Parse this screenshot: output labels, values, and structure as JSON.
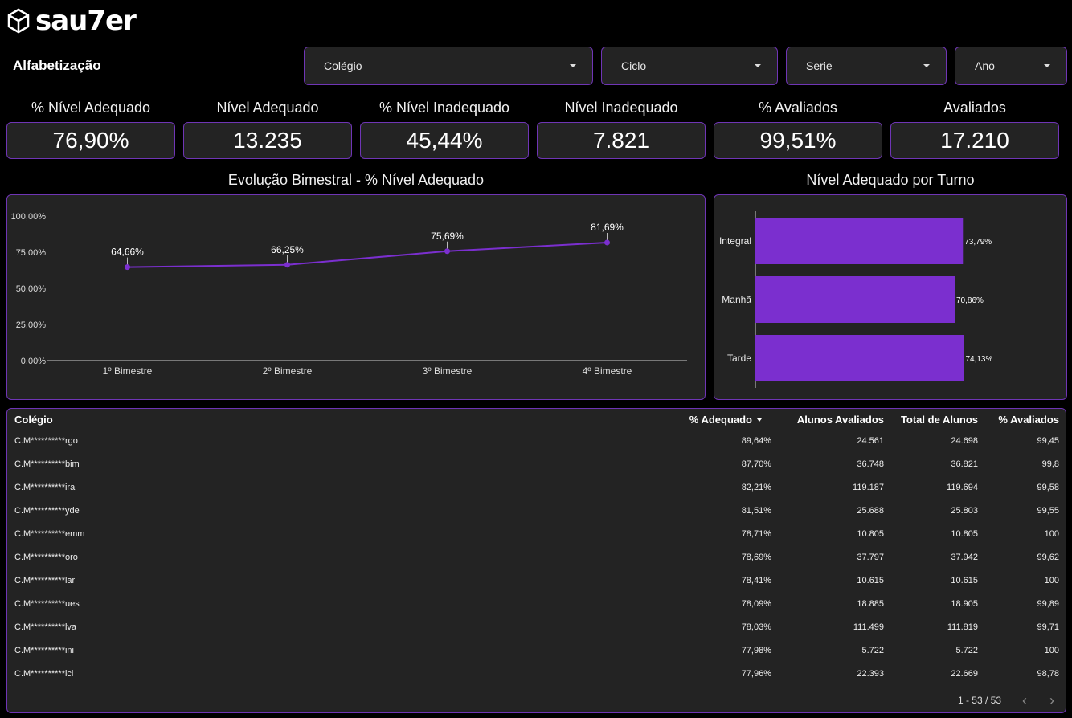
{
  "brand": {
    "name": "sau7er"
  },
  "page": {
    "title": "Alfabetização"
  },
  "filters": [
    {
      "label": "Colégio"
    },
    {
      "label": "Ciclo"
    },
    {
      "label": "Serie"
    },
    {
      "label": "Ano"
    }
  ],
  "kpis": [
    {
      "label": "% Nível Adequado",
      "value": "76,90%"
    },
    {
      "label": "Nível Adequado",
      "value": "13.235"
    },
    {
      "label": "% Nível Inadequado",
      "value": "45,44%"
    },
    {
      "label": "Nível Inadequado",
      "value": "7.821"
    },
    {
      "label": "% Avaliados",
      "value": "99,51%"
    },
    {
      "label": "Avaliados",
      "value": "17.210"
    }
  ],
  "colors": {
    "accent": "#7b2fcf",
    "border": "#6f35b5",
    "panel": "#232323",
    "background": "#000000"
  },
  "chart_data": [
    {
      "type": "line",
      "title": "Evolução Bimestral - % Nível Adequado",
      "categories": [
        "1º Bimestre",
        "2º Bimestre",
        "3º Bimestre",
        "4º Bimestre"
      ],
      "values": [
        64.66,
        66.25,
        75.69,
        81.69
      ],
      "labels": [
        "64,66%",
        "66,25%",
        "75,69%",
        "81,69%"
      ],
      "yticks": [
        "0,00%",
        "25,00%",
        "50,00%",
        "75,00%",
        "100,00%"
      ],
      "ylim": [
        0,
        100
      ],
      "color": "#7b2fcf",
      "grid": false
    },
    {
      "type": "bar",
      "orientation": "horizontal",
      "title": "Nível Adequado por Turno",
      "categories": [
        "Integral",
        "Manhã",
        "Tarde"
      ],
      "values": [
        73.79,
        70.86,
        74.13
      ],
      "labels": [
        "73,79%",
        "70,86%",
        "74,13%"
      ],
      "color": "#7b2fcf"
    }
  ],
  "table": {
    "headers": [
      "Colégio",
      "% Adequado",
      "Alunos Avaliados",
      "Total de Alunos",
      "% Avaliados"
    ],
    "rows": [
      [
        "C.M**********rgo",
        "89,64%",
        "24.561",
        "24.698",
        "99,45"
      ],
      [
        "C.M**********bim",
        "87,70%",
        "36.748",
        "36.821",
        "99,8"
      ],
      [
        "C.M**********ira",
        "82,21%",
        "119.187",
        "119.694",
        "99,58"
      ],
      [
        "C.M**********yde",
        "81,51%",
        "25.688",
        "25.803",
        "99,55"
      ],
      [
        "C.M**********emm",
        "78,71%",
        "10.805",
        "10.805",
        "100"
      ],
      [
        "C.M**********oro",
        "78,69%",
        "37.797",
        "37.942",
        "99,62"
      ],
      [
        "C.M**********lar",
        "78,41%",
        "10.615",
        "10.615",
        "100"
      ],
      [
        "C.M**********ues",
        "78,09%",
        "18.885",
        "18.905",
        "99,89"
      ],
      [
        "C.M**********lva",
        "78,03%",
        "111.499",
        "111.819",
        "99,71"
      ],
      [
        "C.M**********ini",
        "77,98%",
        "5.722",
        "5.722",
        "100"
      ],
      [
        "C.M**********ici",
        "77,96%",
        "22.393",
        "22.669",
        "98,78"
      ]
    ],
    "pagination": "1 - 53 / 53"
  }
}
